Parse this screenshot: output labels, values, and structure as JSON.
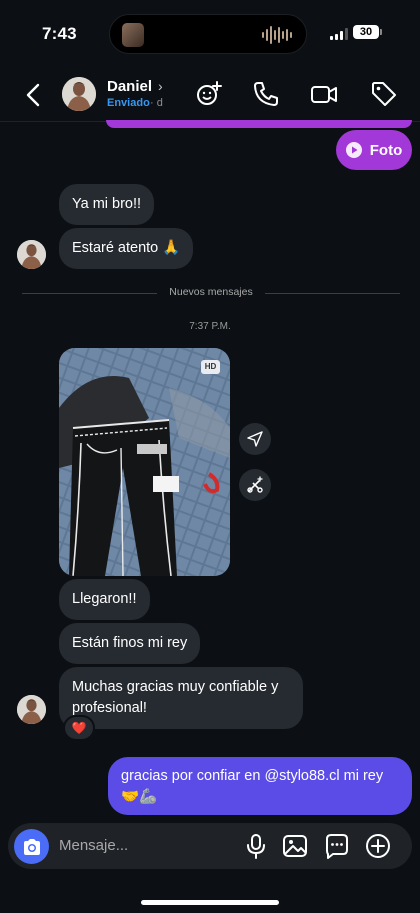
{
  "status": {
    "time": "7:43",
    "battery": "30"
  },
  "header": {
    "name": "Daniel",
    "status": "Enviado",
    "status_extra": "· d"
  },
  "messages": {
    "photo_label": "Foto",
    "m1": "Ya mi bro!!",
    "m2": "Estaré atento 🙏",
    "new_divider": "Nuevos mensajes",
    "timestamp": "7:37 P.M.",
    "hd_badge": "HD",
    "m3": "Llegaron!!",
    "m4": "Están finos mi rey",
    "m5": "Muchas gracias muy confiable y profesional!",
    "reaction": "❤️",
    "m6": "gracias por confiar en @stylo88.cl mi rey 🤝🦾"
  },
  "composer": {
    "placeholder": "Mensaje..."
  },
  "colors": {
    "sent_purple": "#a238d8",
    "sent_blue": "#5b4ce8",
    "received": "#262b31",
    "background": "#0c1014",
    "link": "#3897f0"
  },
  "icons": [
    "back-icon",
    "add-member-icon",
    "phone-icon",
    "video-icon",
    "tag-icon",
    "share-icon",
    "tools-icon",
    "camera-icon",
    "microphone-icon",
    "gallery-icon",
    "sticker-icon",
    "plus-icon"
  ]
}
